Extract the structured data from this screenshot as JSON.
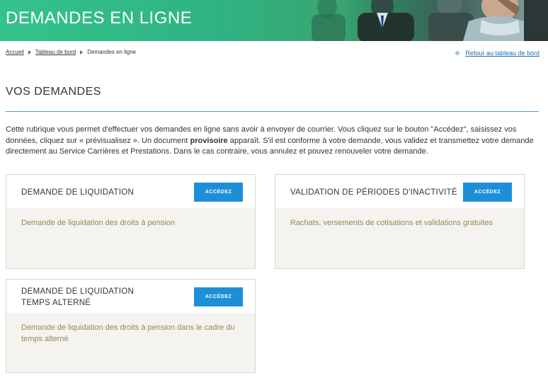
{
  "banner": {
    "title": "DEMANDES EN LIGNE"
  },
  "breadcrumb": {
    "home": "Accueil",
    "dashboard": "Tableau de bord",
    "current": "Demandes en ligne"
  },
  "back_link": "Retour au tableau de bord",
  "section": {
    "title": "VOS DEMANDES",
    "intro_part1": "Cette rubrique vous permet d'effectuer vos demandes en ligne sans avoir à envoyer de courrier. Vous cliquez sur le bouton \"Accédez\", saisissez vos données, cliquez sur « prévisualisez ». Un document ",
    "intro_bold": "provisoire",
    "intro_part2": " apparaît. S'il est conforme à votre demande, vous validez et transmettez votre demande directement au Service Carrières et Prestations. Dans le cas contraire, vous annulez et pouvez renouveler votre demande."
  },
  "cards": [
    {
      "title": "DEMANDE DE LIQUIDATION",
      "button": "ACCÉDEZ",
      "description": "Demande de liquidation des droits à pension"
    },
    {
      "title": "VALIDATION DE PÉRIODES D'INACTIVITÉ",
      "button": "ACCÉDEZ",
      "description": "Rachats, versements de cotisations et validations gratuites"
    },
    {
      "title": "DEMANDE DE LIQUIDATION TEMPS ALTERNÉ",
      "button": "ACCÉDEZ",
      "description": "Demande de liquidation des droits à pension dans le cadre du temps alterné"
    }
  ]
}
